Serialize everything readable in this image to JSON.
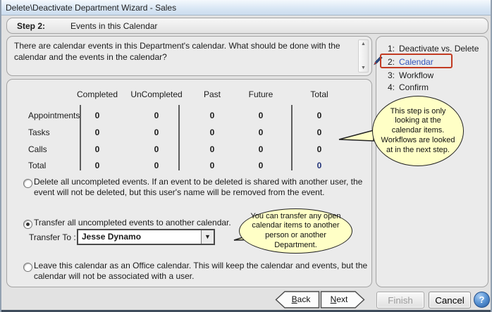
{
  "window": {
    "title": "Delete\\Deactivate Department Wizard - Sales"
  },
  "step_header": {
    "step_label": "Step 2:",
    "title": "Events in this Calendar"
  },
  "description": "There are calendar events in this Department's calendar. What should be done with the calendar and the events in the calendar?",
  "steps": {
    "items": [
      {
        "num": "1:",
        "label": "Deactivate vs. Delete"
      },
      {
        "num": "2:",
        "label": "Calendar"
      },
      {
        "num": "3:",
        "label": "Workflow"
      },
      {
        "num": "4:",
        "label": "Confirm"
      }
    ],
    "current_index": 1
  },
  "table": {
    "headers": [
      "Completed",
      "UnCompleted",
      "Past",
      "Future",
      "Total"
    ],
    "rows": [
      {
        "label": "Appointments",
        "values": [
          "0",
          "0",
          "0",
          "0",
          "0"
        ]
      },
      {
        "label": "Tasks",
        "values": [
          "0",
          "0",
          "0",
          "0",
          "0"
        ]
      },
      {
        "label": "Calls",
        "values": [
          "0",
          "0",
          "0",
          "0",
          "0"
        ]
      },
      {
        "label": "Total",
        "values": [
          "0",
          "0",
          "0",
          "0",
          "0"
        ]
      }
    ]
  },
  "options": {
    "delete_label": "Delete all uncompleted events. If an event to be deleted is shared with another user, the event will not be deleted, but this user's name will be removed from the event.",
    "transfer_label": "Transfer all uncompleted events to another calendar.",
    "transfer_to_label": "Transfer To :",
    "transfer_to_value": "Jesse Dynamo",
    "leave_label": "Leave this calendar as an Office calendar.  This will keep the calendar and events, but the calendar will not be associated with a user.",
    "selected": "transfer"
  },
  "callouts": {
    "step_note": "This step is only looking at the calendar items. Workflows are looked at in the next step.",
    "transfer_note": "You can transfer any open calendar items to another person or another Department."
  },
  "buttons": {
    "back": "Back",
    "next": "Next",
    "finish": "Finish",
    "cancel": "Cancel"
  },
  "icons": {
    "scroll_up": "▲",
    "scroll_down": "▼",
    "combo_arrow": "▼",
    "help": "?"
  },
  "colors": {
    "callout_bg": "#FFFFC6",
    "highlight_red": "#C23B22",
    "current_step_blue": "#3355BB",
    "total_blue": "#223377",
    "titlebar_top": "#F4F9FD",
    "titlebar_bottom": "#CBDCEE"
  }
}
